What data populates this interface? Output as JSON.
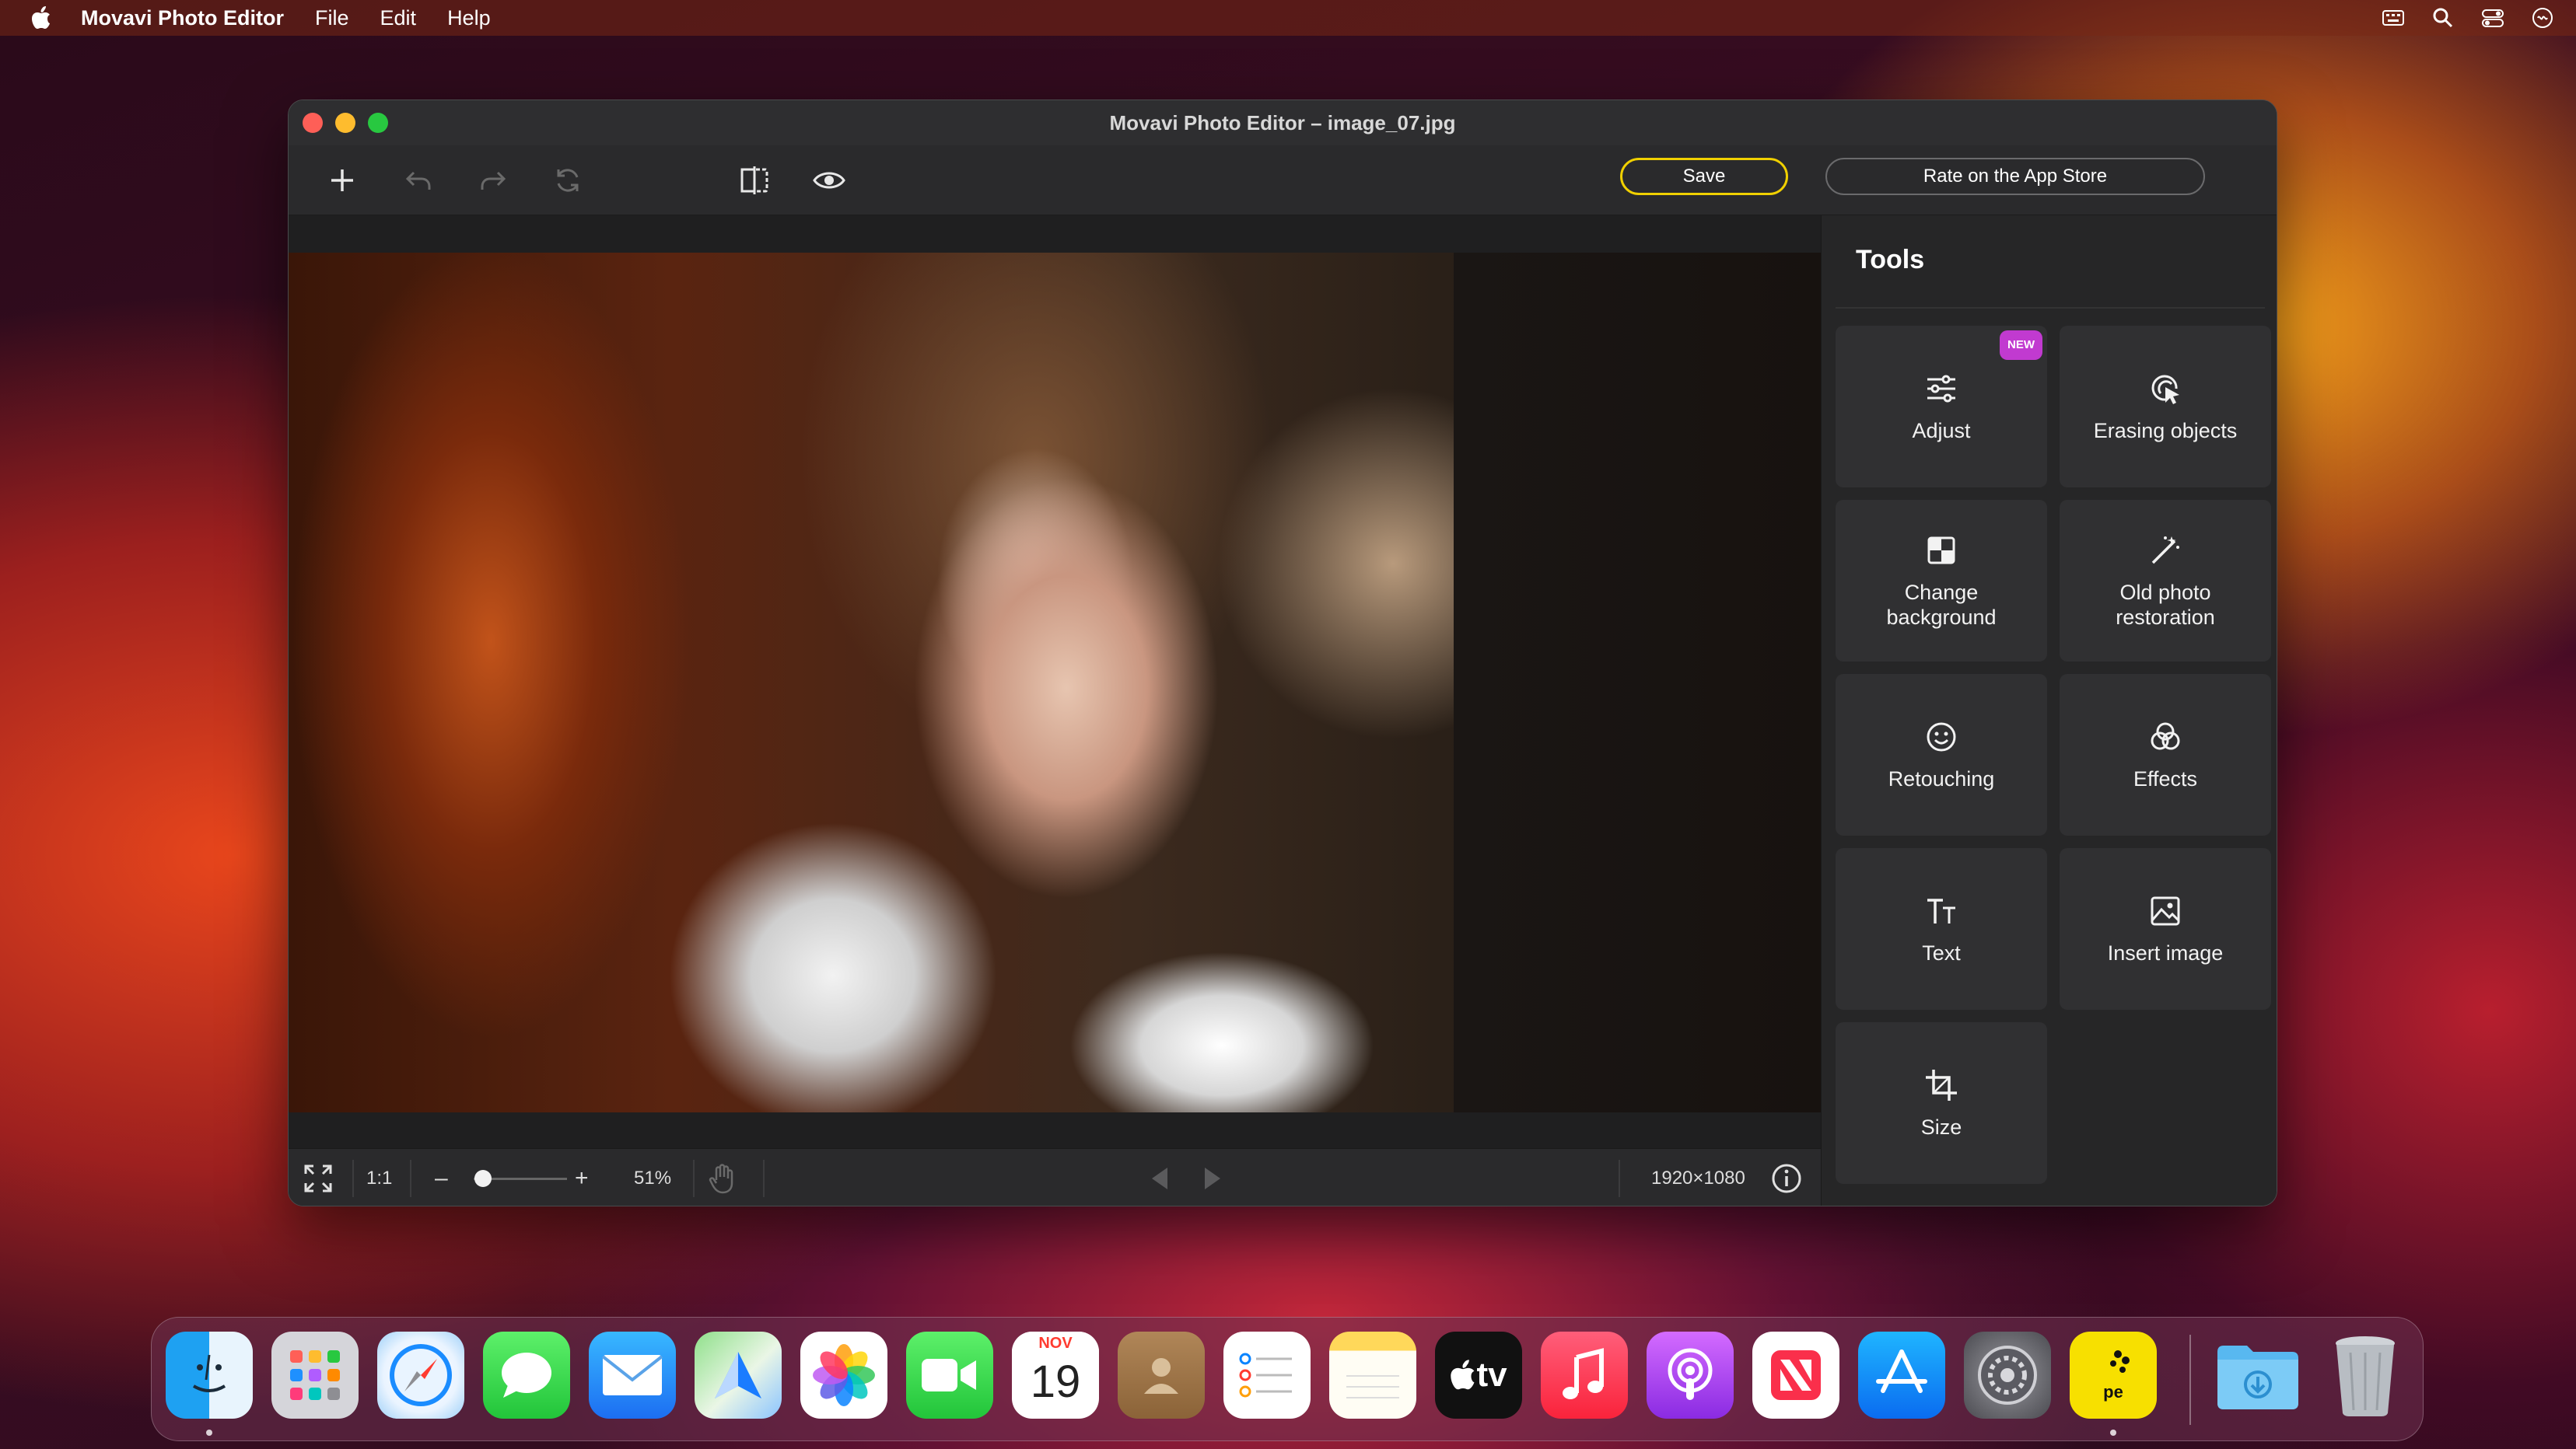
{
  "menubar": {
    "app_name": "Movavi Photo Editor",
    "menus": [
      "File",
      "Edit",
      "Help"
    ]
  },
  "window": {
    "title": "Movavi Photo Editor – image_07.jpg"
  },
  "toolbar": {
    "save_label": "Save",
    "rate_label": "Rate on the App Store"
  },
  "bottombar": {
    "ratio_label": "1:1",
    "zoom_minus": "–",
    "zoom_plus": "+",
    "zoom_level": "51%",
    "zoom_fraction": 0.1,
    "resolution": "1920×1080"
  },
  "tools": {
    "title": "Tools",
    "badge_new": "NEW",
    "items": [
      {
        "label": "Adjust",
        "icon": "sliders-icon"
      },
      {
        "label": "Erasing objects",
        "icon": "eraser-cursor-icon"
      },
      {
        "label": "Change\nbackground",
        "icon": "background-icon"
      },
      {
        "label": "Old photo\nrestoration",
        "icon": "magic-wand-icon"
      },
      {
        "label": "Retouching",
        "icon": "smiley-icon"
      },
      {
        "label": "Effects",
        "icon": "effects-circles-icon"
      },
      {
        "label": "Text",
        "icon": "text-tt-icon"
      },
      {
        "label": "Insert image",
        "icon": "insert-image-icon"
      },
      {
        "label": "Size",
        "icon": "crop-icon"
      }
    ]
  },
  "dock": {
    "calendar_month": "NOV",
    "calendar_day": "19",
    "tv_label": "tv",
    "pe_label": "pe"
  },
  "colors": {
    "save_border": "#f0d000",
    "new_badge": "#c13ad0",
    "panel_bg": "#262627",
    "card_bg": "#303032"
  }
}
